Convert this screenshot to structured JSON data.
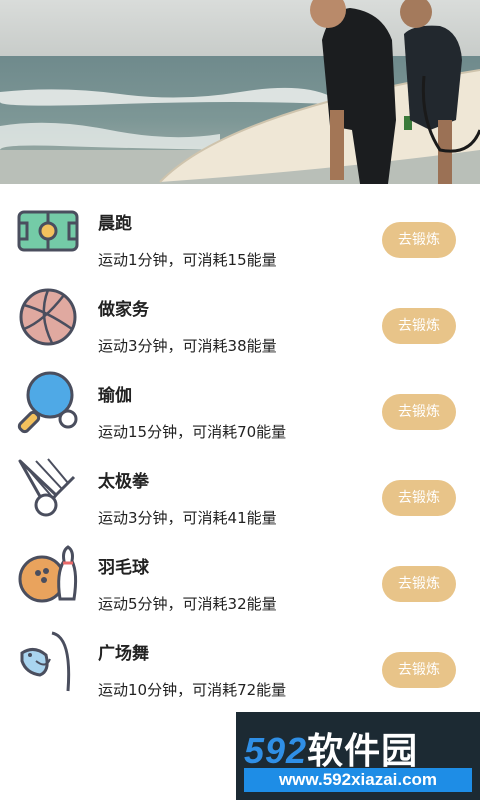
{
  "colors": {
    "button_bg": "#e8c489",
    "button_text": "#ffffff",
    "text_primary": "#222222"
  },
  "exercises": [
    {
      "title": "晨跑",
      "desc": "运动1分钟，可消耗15能量",
      "button": "去锻炼",
      "icon": "soccer-field-icon"
    },
    {
      "title": "做家务",
      "desc": "运动3分钟，可消耗38能量",
      "button": "去锻炼",
      "icon": "volleyball-icon"
    },
    {
      "title": "瑜伽",
      "desc": "运动15分钟，可消耗70能量",
      "button": "去锻炼",
      "icon": "ping-pong-icon"
    },
    {
      "title": "太极拳",
      "desc": "运动3分钟，可消耗41能量",
      "button": "去锻炼",
      "icon": "shuttlecock-icon"
    },
    {
      "title": "羽毛球",
      "desc": "运动5分钟，可消耗32能量",
      "button": "去锻炼",
      "icon": "bowling-icon"
    },
    {
      "title": "广场舞",
      "desc": "运动10分钟，可消耗72能量",
      "button": "去锻炼",
      "icon": "fishing-icon"
    }
  ],
  "watermark": {
    "brand_num": "592",
    "brand_cn": "软件园",
    "url": "www.592xiazai.com"
  }
}
